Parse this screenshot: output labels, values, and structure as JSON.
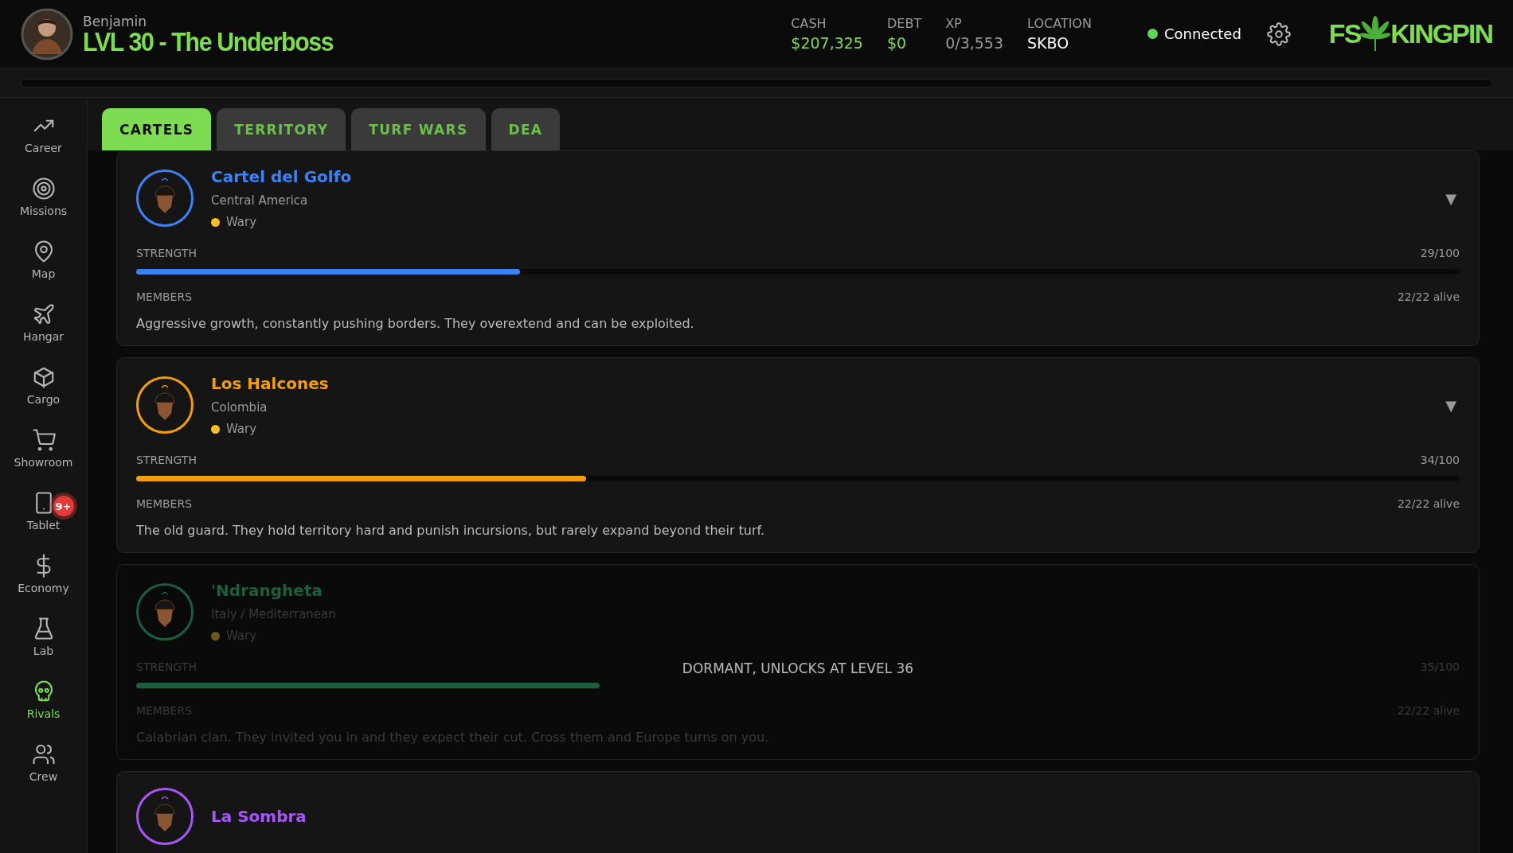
{
  "header": {
    "player_name": "Benjamin",
    "rank": "LVL 30 - The Underboss",
    "stats": [
      {
        "label": "CASH",
        "value": "$207,325",
        "kind": "money"
      },
      {
        "label": "DEBT",
        "value": "$0",
        "kind": "money"
      },
      {
        "label": "XP",
        "value": "0/3,553",
        "kind": "progress"
      },
      {
        "label": "LOCATION",
        "value": "SKBO",
        "kind": "place"
      }
    ],
    "connection": {
      "label": "Connected",
      "on": true
    },
    "logo": {
      "left": "FS",
      "right": "KINGPIN"
    }
  },
  "xp_bar": {
    "level": 0
  },
  "sidebar": {
    "items": [
      {
        "label": "Career",
        "selected": false
      },
      {
        "label": "Missions",
        "selected": false
      },
      {
        "label": "Map",
        "selected": false
      },
      {
        "label": "Hangar",
        "selected": false
      },
      {
        "label": "Cargo",
        "selected": false
      },
      {
        "label": "Showroom",
        "selected": false
      },
      {
        "label": "Tablet",
        "selected": false,
        "badge": "9+"
      },
      {
        "label": "Economy",
        "selected": false
      },
      {
        "label": "Lab",
        "selected": false
      },
      {
        "label": "Rivals",
        "selected": true
      },
      {
        "label": "Crew",
        "selected": false
      }
    ]
  },
  "tabs": [
    {
      "label": "CARTELS",
      "selected": true
    },
    {
      "label": "TERRITORY",
      "selected": false
    },
    {
      "label": "TURF WARS",
      "selected": false
    },
    {
      "label": "DEA",
      "selected": false
    }
  ],
  "cartels": [
    {
      "name": "Cartel del Golfo",
      "region": "Central America",
      "color": "#3b82f6",
      "dormant": false,
      "toggle": "▼",
      "status": {
        "label": "Wary",
        "color": "#fbbf24"
      },
      "strength": {
        "label": "STRENGTH",
        "value": "29/100",
        "level": 0.29
      },
      "members": {
        "label": "MEMBERS",
        "value": "22/22 alive"
      },
      "description": "Aggressive growth, constantly pushing borders. They overextend and can be exploited."
    },
    {
      "name": "Los Halcones",
      "region": "Colombia",
      "color": "#f59e0b",
      "dormant": false,
      "toggle": "▼",
      "status": {
        "label": "Wary",
        "color": "#fbbf24"
      },
      "strength": {
        "label": "STRENGTH",
        "value": "34/100",
        "level": 0.34
      },
      "members": {
        "label": "MEMBERS",
        "value": "22/22 alive"
      },
      "description": "The old guard. They hold territory hard and punish incursions, but rarely expand beyond their turf."
    },
    {
      "name": "'Ndrangheta",
      "region": "Italy / Mediterranean",
      "color": "#1d5e3f",
      "dormant": true,
      "lock_note": "DORMANT, UNLOCKS AT LEVEL 36",
      "status": {
        "label": "Wary",
        "color": "#6e5a1c"
      },
      "strength": {
        "label": "STRENGTH",
        "value": "35/100",
        "level": 0.35
      },
      "members": {
        "label": "MEMBERS",
        "value": "22/22 alive"
      },
      "description": "Calabrian clan. They invited you in and they expect their cut. Cross them and Europe turns on you."
    },
    {
      "name": "La Sombra",
      "color": "#a855f7"
    }
  ]
}
